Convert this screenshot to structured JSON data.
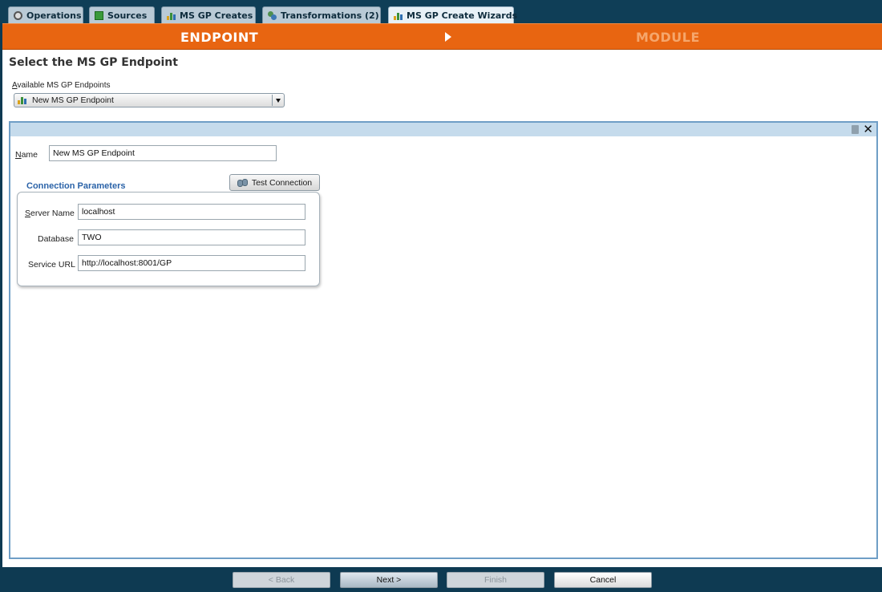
{
  "tabs": [
    {
      "label": "Operations",
      "icon": "gear-icon"
    },
    {
      "label": "Sources",
      "icon": "source-icon"
    },
    {
      "label": "MS GP Creates",
      "icon": "chart-icon"
    },
    {
      "label": "Transformations (2)",
      "icon": "gears-icon"
    },
    {
      "label": "MS GP Create Wizards",
      "icon": "chart-icon",
      "active": true
    }
  ],
  "steps": {
    "current": "ENDPOINT",
    "next": "MODULE"
  },
  "page_title": "Select the MS GP  Endpoint",
  "endpoints": {
    "label": "Available MS GP Endpoints",
    "selected": "New MS GP Endpoint"
  },
  "form": {
    "name_label": "Name",
    "name_value": "New MS GP Endpoint",
    "conn_title": "Connection Parameters",
    "test_button": "Test Connection",
    "server_label": "Server Name",
    "server_value": "localhost",
    "database_label": "Database",
    "database_value": "TWO",
    "url_label": "Service URL",
    "url_value": "http://localhost:8001/GP"
  },
  "nav": {
    "back": "< Back",
    "next": "Next >",
    "finish": "Finish",
    "cancel": "Cancel"
  },
  "colors": {
    "accent": "#e86511",
    "titlebar": "#0e3a52",
    "link_blue": "#2b63a8"
  }
}
